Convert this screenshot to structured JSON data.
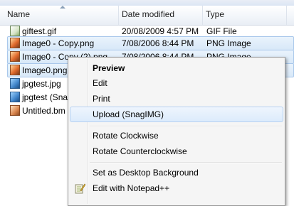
{
  "columns": {
    "name": "Name",
    "date_modified": "Date modified",
    "type": "Type"
  },
  "files": [
    {
      "name": "giftest.gif",
      "date": "20/08/2009 4:57 PM",
      "type": "GIF File",
      "icon": "gif-file-icon",
      "selected": false
    },
    {
      "name": "Image0 - Copy.png",
      "date": "7/08/2006 8:44 PM",
      "type": "PNG Image",
      "icon": "png-file-icon",
      "selected": true
    },
    {
      "name": "Image0 - Copy (2).png",
      "date": "7/08/2006 8:44 PM",
      "type": "PNG Image",
      "icon": "png-file-icon",
      "selected": true
    },
    {
      "name": "Image0.png",
      "date": "",
      "type": "",
      "icon": "png-file-icon",
      "selected": true
    },
    {
      "name": "jpgtest.jpg",
      "date": "",
      "type": "",
      "icon": "jpg-file-icon",
      "selected": false
    },
    {
      "name": "jpgtest (Snag",
      "date": "",
      "type": "",
      "icon": "jpg-file-icon",
      "selected": false
    },
    {
      "name": "Untitled.bm",
      "date": "",
      "type": "",
      "icon": "bmp-file-icon",
      "selected": false
    }
  ],
  "context_menu": {
    "preview": "Preview",
    "edit": "Edit",
    "print": "Print",
    "upload": "Upload (SnagIMG)",
    "rotate_cw": "Rotate Clockwise",
    "rotate_ccw": "Rotate Counterclockwise",
    "set_background": "Set as Desktop Background",
    "edit_notepad": "Edit with Notepad++"
  }
}
